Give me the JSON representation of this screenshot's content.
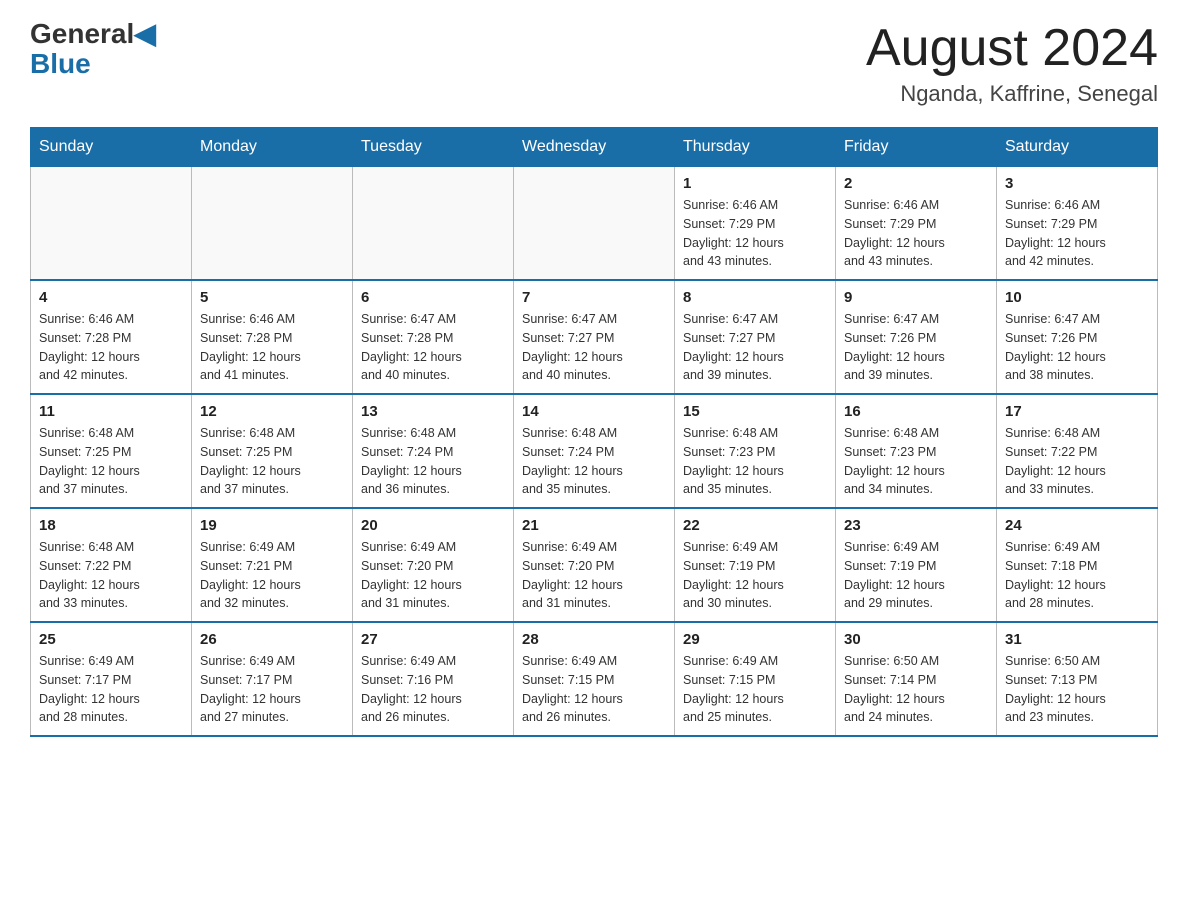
{
  "header": {
    "logo_general": "General",
    "logo_blue": "Blue",
    "month_title": "August 2024",
    "location": "Nganda, Kaffrine, Senegal"
  },
  "days_of_week": [
    "Sunday",
    "Monday",
    "Tuesday",
    "Wednesday",
    "Thursday",
    "Friday",
    "Saturday"
  ],
  "weeks": [
    [
      {
        "day": "",
        "info": ""
      },
      {
        "day": "",
        "info": ""
      },
      {
        "day": "",
        "info": ""
      },
      {
        "day": "",
        "info": ""
      },
      {
        "day": "1",
        "info": "Sunrise: 6:46 AM\nSunset: 7:29 PM\nDaylight: 12 hours\nand 43 minutes."
      },
      {
        "day": "2",
        "info": "Sunrise: 6:46 AM\nSunset: 7:29 PM\nDaylight: 12 hours\nand 43 minutes."
      },
      {
        "day": "3",
        "info": "Sunrise: 6:46 AM\nSunset: 7:29 PM\nDaylight: 12 hours\nand 42 minutes."
      }
    ],
    [
      {
        "day": "4",
        "info": "Sunrise: 6:46 AM\nSunset: 7:28 PM\nDaylight: 12 hours\nand 42 minutes."
      },
      {
        "day": "5",
        "info": "Sunrise: 6:46 AM\nSunset: 7:28 PM\nDaylight: 12 hours\nand 41 minutes."
      },
      {
        "day": "6",
        "info": "Sunrise: 6:47 AM\nSunset: 7:28 PM\nDaylight: 12 hours\nand 40 minutes."
      },
      {
        "day": "7",
        "info": "Sunrise: 6:47 AM\nSunset: 7:27 PM\nDaylight: 12 hours\nand 40 minutes."
      },
      {
        "day": "8",
        "info": "Sunrise: 6:47 AM\nSunset: 7:27 PM\nDaylight: 12 hours\nand 39 minutes."
      },
      {
        "day": "9",
        "info": "Sunrise: 6:47 AM\nSunset: 7:26 PM\nDaylight: 12 hours\nand 39 minutes."
      },
      {
        "day": "10",
        "info": "Sunrise: 6:47 AM\nSunset: 7:26 PM\nDaylight: 12 hours\nand 38 minutes."
      }
    ],
    [
      {
        "day": "11",
        "info": "Sunrise: 6:48 AM\nSunset: 7:25 PM\nDaylight: 12 hours\nand 37 minutes."
      },
      {
        "day": "12",
        "info": "Sunrise: 6:48 AM\nSunset: 7:25 PM\nDaylight: 12 hours\nand 37 minutes."
      },
      {
        "day": "13",
        "info": "Sunrise: 6:48 AM\nSunset: 7:24 PM\nDaylight: 12 hours\nand 36 minutes."
      },
      {
        "day": "14",
        "info": "Sunrise: 6:48 AM\nSunset: 7:24 PM\nDaylight: 12 hours\nand 35 minutes."
      },
      {
        "day": "15",
        "info": "Sunrise: 6:48 AM\nSunset: 7:23 PM\nDaylight: 12 hours\nand 35 minutes."
      },
      {
        "day": "16",
        "info": "Sunrise: 6:48 AM\nSunset: 7:23 PM\nDaylight: 12 hours\nand 34 minutes."
      },
      {
        "day": "17",
        "info": "Sunrise: 6:48 AM\nSunset: 7:22 PM\nDaylight: 12 hours\nand 33 minutes."
      }
    ],
    [
      {
        "day": "18",
        "info": "Sunrise: 6:48 AM\nSunset: 7:22 PM\nDaylight: 12 hours\nand 33 minutes."
      },
      {
        "day": "19",
        "info": "Sunrise: 6:49 AM\nSunset: 7:21 PM\nDaylight: 12 hours\nand 32 minutes."
      },
      {
        "day": "20",
        "info": "Sunrise: 6:49 AM\nSunset: 7:20 PM\nDaylight: 12 hours\nand 31 minutes."
      },
      {
        "day": "21",
        "info": "Sunrise: 6:49 AM\nSunset: 7:20 PM\nDaylight: 12 hours\nand 31 minutes."
      },
      {
        "day": "22",
        "info": "Sunrise: 6:49 AM\nSunset: 7:19 PM\nDaylight: 12 hours\nand 30 minutes."
      },
      {
        "day": "23",
        "info": "Sunrise: 6:49 AM\nSunset: 7:19 PM\nDaylight: 12 hours\nand 29 minutes."
      },
      {
        "day": "24",
        "info": "Sunrise: 6:49 AM\nSunset: 7:18 PM\nDaylight: 12 hours\nand 28 minutes."
      }
    ],
    [
      {
        "day": "25",
        "info": "Sunrise: 6:49 AM\nSunset: 7:17 PM\nDaylight: 12 hours\nand 28 minutes."
      },
      {
        "day": "26",
        "info": "Sunrise: 6:49 AM\nSunset: 7:17 PM\nDaylight: 12 hours\nand 27 minutes."
      },
      {
        "day": "27",
        "info": "Sunrise: 6:49 AM\nSunset: 7:16 PM\nDaylight: 12 hours\nand 26 minutes."
      },
      {
        "day": "28",
        "info": "Sunrise: 6:49 AM\nSunset: 7:15 PM\nDaylight: 12 hours\nand 26 minutes."
      },
      {
        "day": "29",
        "info": "Sunrise: 6:49 AM\nSunset: 7:15 PM\nDaylight: 12 hours\nand 25 minutes."
      },
      {
        "day": "30",
        "info": "Sunrise: 6:50 AM\nSunset: 7:14 PM\nDaylight: 12 hours\nand 24 minutes."
      },
      {
        "day": "31",
        "info": "Sunrise: 6:50 AM\nSunset: 7:13 PM\nDaylight: 12 hours\nand 23 minutes."
      }
    ]
  ]
}
